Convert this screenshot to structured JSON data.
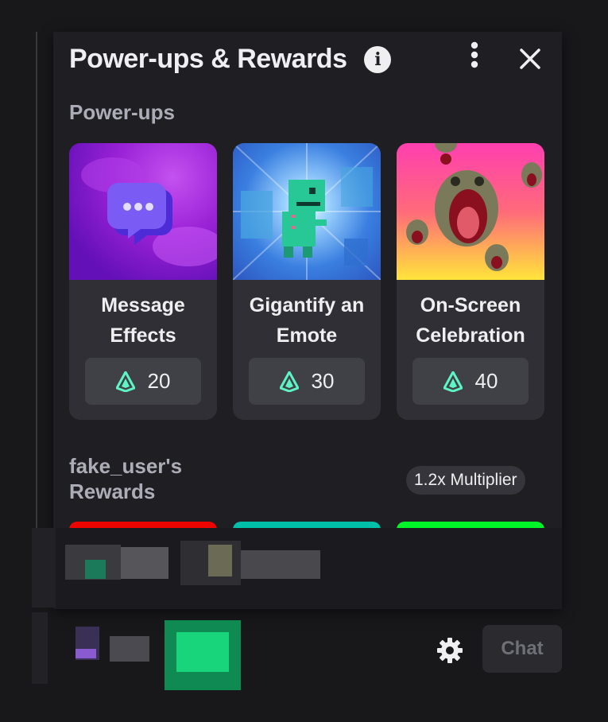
{
  "panel": {
    "title": "Power-ups & Rewards",
    "info_glyph": "i",
    "info_icon": "info-icon",
    "more_icon": "more-vertical-icon",
    "close_icon": "close-icon"
  },
  "powerups": {
    "label": "Power-ups",
    "items": [
      {
        "title_line1": "Message",
        "title_line2": "Effects",
        "cost": "20",
        "icon": "message-effects-chat-bubble-icon",
        "bg": "#a02ce0"
      },
      {
        "title_line1": "Gigantify an",
        "title_line2": "Emote",
        "cost": "30",
        "icon": "pixel-dinosaur-emote-icon",
        "bg": "#3f8ed8"
      },
      {
        "title_line1": "On-Screen",
        "title_line2": "Celebration",
        "cost": "40",
        "icon": "screaming-lizard-celebration-icon",
        "bg": "#ff3fa8"
      }
    ],
    "currency_icon": "channel-points-icon",
    "currency_color": "#5ef5c5"
  },
  "rewards": {
    "title_line1": "fake_user's",
    "title_line2": "Rewards",
    "multiplier": "1.2x Multiplier",
    "strip_colors": [
      "#eb0400",
      "#00bfa8",
      "#00f529"
    ]
  },
  "chat_bar": {
    "settings_icon": "gear-icon",
    "chat_label": "Chat"
  },
  "colors": {
    "background": "#18181b",
    "panel": "#1f1f23",
    "card": "#2f2f35",
    "price_chip": "#404047",
    "muted_text": "#adadb8"
  }
}
